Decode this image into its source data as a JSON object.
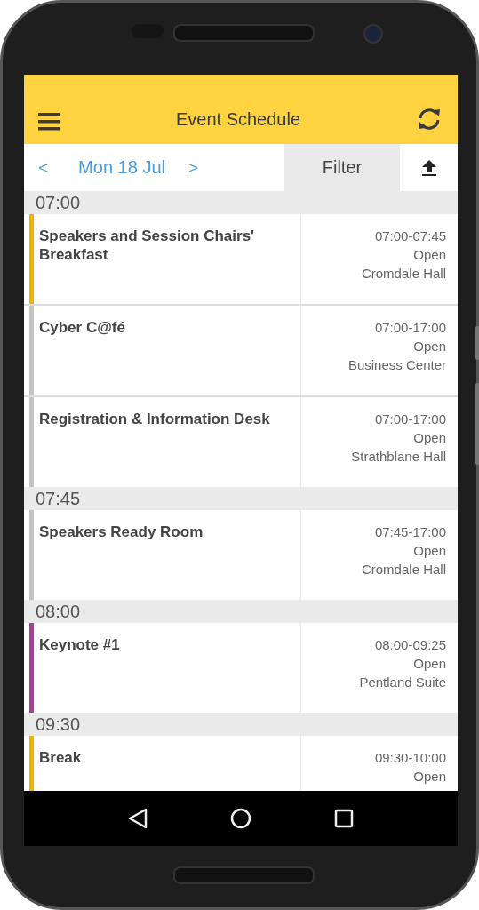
{
  "app_bar": {
    "title": "Event Schedule"
  },
  "date_bar": {
    "prev": "<",
    "date": "Mon 18 Jul",
    "next": ">",
    "filter": "Filter"
  },
  "groups": [
    {
      "time": "07:00",
      "events": [
        {
          "title": "Speakers and Session Chairs' Breakfast",
          "time": "07:00-07:45",
          "status": "Open",
          "venue": "Cromdale Hall",
          "color": "#f0b400"
        },
        {
          "title": "Cyber C@fé",
          "time": "07:00-17:00",
          "status": "Open",
          "venue": "Business Center",
          "color": "#c4c4c4"
        },
        {
          "title": "Registration & Information Desk",
          "time": "07:00-17:00",
          "status": "Open",
          "venue": "Strathblane Hall",
          "color": "#c4c4c4"
        }
      ]
    },
    {
      "time": "07:45",
      "events": [
        {
          "title": "Speakers Ready Room",
          "time": "07:45-17:00",
          "status": "Open",
          "venue": "Cromdale Hall",
          "color": "#c4c4c4"
        }
      ]
    },
    {
      "time": "08:00",
      "events": [
        {
          "title": "Keynote #1",
          "time": "08:00-09:25",
          "status": "Open",
          "venue": "Pentland Suite",
          "color": "#b03a9c"
        }
      ]
    },
    {
      "time": "09:30",
      "events": [
        {
          "title": "Break",
          "time": "09:30-10:00",
          "status": "Open",
          "color": "#f0b400"
        }
      ]
    }
  ]
}
